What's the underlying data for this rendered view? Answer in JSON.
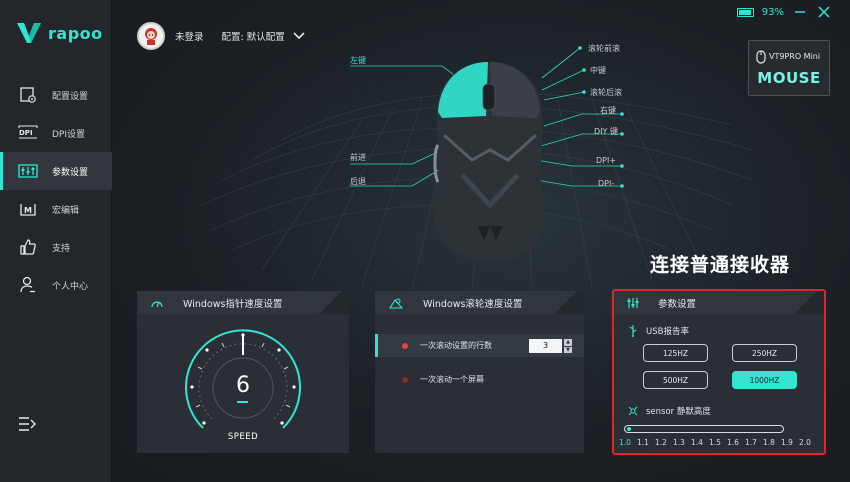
{
  "app": {
    "logo_text": "rapoo"
  },
  "user": {
    "name": "未登录",
    "profile": "配置: 默认配置"
  },
  "status": {
    "battery": "93%"
  },
  "device": {
    "model": "VT9PRO Mini",
    "type": "MOUSE"
  },
  "sidebar": {
    "items": [
      {
        "label": "配置设置",
        "icon": "config-icon"
      },
      {
        "label": "DPI设置",
        "icon": "dpi-icon"
      },
      {
        "label": "参数设置",
        "icon": "params-icon",
        "active": true
      },
      {
        "label": "宏编辑",
        "icon": "macro-icon"
      },
      {
        "label": "支持",
        "icon": "thumbs-up-icon"
      },
      {
        "label": "个人中心",
        "icon": "user-icon"
      }
    ]
  },
  "mouse_labels": {
    "left": "左键",
    "scroll_forward": "滚轮前滚",
    "middle": "中键",
    "scroll_back": "滚轮后滚",
    "right": "右键",
    "diy": "DIY 键",
    "forward": "前进",
    "back": "后退",
    "dpi_plus": "DPI+",
    "dpi_minus": "DPI-"
  },
  "connection_banner": "连接普通接收器",
  "pointer_panel": {
    "title": "Windows指针速度设置",
    "value": "6",
    "label": "SPEED"
  },
  "scroll_panel": {
    "title": "Windows滚轮速度设置",
    "option_lines": "一次滚动设置的行数",
    "lines_value": "3",
    "option_screen": "一次滚动一个屏幕"
  },
  "params_panel": {
    "title": "参数设置",
    "usb_label": "USB报告率",
    "rates": [
      "125HZ",
      "250HZ",
      "500HZ",
      "1000HZ"
    ],
    "selected_rate": "1000HZ",
    "sensor_label": "sensor 静默高度",
    "lod_ticks": [
      "1.0",
      "1.1",
      "1.2",
      "1.3",
      "1.4",
      "1.5",
      "1.6",
      "1.7",
      "1.8",
      "1.9",
      "2.0"
    ],
    "lod_value": 1.0
  },
  "colors": {
    "accent": "#30e6d2",
    "highlight_border": "#e0232f"
  }
}
